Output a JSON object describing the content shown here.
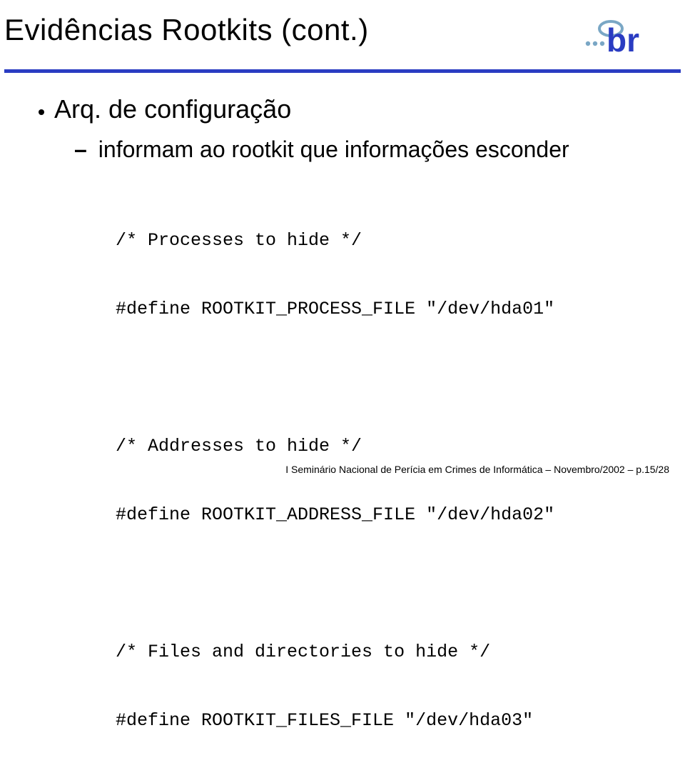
{
  "header": {
    "title": "Evidências Rootkits (cont.)"
  },
  "content": {
    "bullet1": "Arq. de configuração",
    "sub1": "informam ao rootkit que informações esconder",
    "code": {
      "l1": "/* Processes to hide */",
      "l2": "#define ROOTKIT_PROCESS_FILE \"/dev/hda01\"",
      "l3": "",
      "l4": "/* Addresses to hide */",
      "l5": "#define ROOTKIT_ADDRESS_FILE \"/dev/hda02\"",
      "l6": "",
      "l7": "/* Files and directories to hide */",
      "l8": "#define ROOTKIT_FILES_FILE \"/dev/hda03\""
    }
  },
  "footer": {
    "text": "I Seminário Nacional de Perícia em Crimes de Informática – Novembro/2002 – p.15/28"
  },
  "logo": {
    "dots_color": "#7aa7c5",
    "text_color": "#2a3cc2"
  }
}
